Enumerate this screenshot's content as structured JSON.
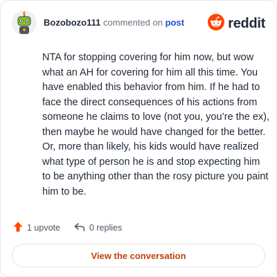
{
  "header": {
    "username": "Bozobozo111",
    "action_text": "commented on",
    "post_link": "post",
    "avatar_icon": "robot-avatar-icon"
  },
  "brand": {
    "logo_icon": "reddit-logo-icon",
    "wordmark": "reddit",
    "color": "#ff4500"
  },
  "comment": {
    "text": "NTA for stopping covering for him now, but wow what an AH for covering for him all this time. You have enabled this behavior from him. If he had to face the direct consequences of his actions from someone he claims to love (not you, you’re the ex), then maybe he would have changed for the better. Or, more than likely, his kids would have realized what type of person he is and stop expecting him to be anything other than the rosy picture you paint him to be."
  },
  "actions": {
    "upvote_label": "1 upvote",
    "upvote_icon": "upvote-arrow-icon",
    "replies_label": "0 replies",
    "reply_icon": "reply-arrow-icon"
  },
  "cta": {
    "label": "View the conversation",
    "color": "#c2410c"
  }
}
